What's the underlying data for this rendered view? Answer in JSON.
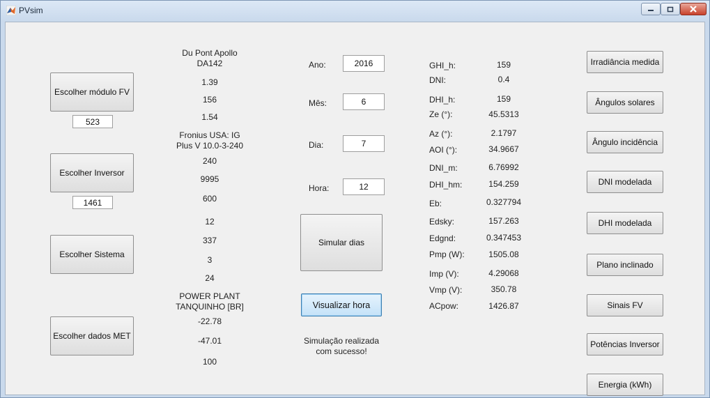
{
  "window": {
    "title": "PVsim"
  },
  "left_buttons": {
    "modulo": "Escolher módulo FV",
    "inversor": "Escolher Inversor",
    "sistema": "Escolher Sistema",
    "met": "Escolher dados MET"
  },
  "left_fields": {
    "modulo_id": "523",
    "inversor_id": "1461"
  },
  "info_column": {
    "module_name": "Du Pont Apollo\nDA142",
    "module_values": [
      "1.39",
      "156",
      "1.54"
    ],
    "inverter_name": "Fronius USA: IG\nPlus V 10.0-3-240",
    "inverter_values": [
      "240",
      "9995",
      "600"
    ],
    "system_values": [
      "12",
      "337",
      "3",
      "24"
    ],
    "met_name": "POWER PLANT\nTANQUINHO [BR]",
    "met_values": [
      "-22.78",
      "-47.01",
      "100"
    ]
  },
  "date_inputs": [
    {
      "label": "Ano:",
      "value": "2016"
    },
    {
      "label": "Mês:",
      "value": "6"
    },
    {
      "label": "Dia:",
      "value": "7"
    },
    {
      "label": "Hora:",
      "value": "12"
    }
  ],
  "actions": {
    "simular": "Simular dias",
    "visualizar": "Visualizar hora",
    "status": "Simulação realizada\ncom sucesso!"
  },
  "results": [
    {
      "label": "GHI_h:",
      "value": "159"
    },
    {
      "label": "DNI:",
      "value": "0.4"
    },
    {
      "label": "DHI_h:",
      "value": "159"
    },
    {
      "label": "Ze (°):",
      "value": "45.5313"
    },
    {
      "label": "Az (°):",
      "value": "2.1797"
    },
    {
      "label": "AOI (°):",
      "value": "34.9667"
    },
    {
      "label": "DNI_m:",
      "value": "6.76992"
    },
    {
      "label": "DHI_hm:",
      "value": "154.259"
    },
    {
      "label": "Eb:",
      "value": "0.327794"
    },
    {
      "label": "Edsky:",
      "value": "157.263"
    },
    {
      "label": "Edgnd:",
      "value": "0.347453"
    },
    {
      "label": "Pmp (W):",
      "value": "1505.08"
    },
    {
      "label": "Imp (V):",
      "value": "4.29068"
    },
    {
      "label": "Vmp (V):",
      "value": "350.78"
    },
    {
      "label": "ACpow:",
      "value": "1426.87"
    }
  ],
  "right_buttons": [
    "Irradiância medida",
    "Ângulos solares",
    "Ângulo incidência",
    "DNI modelada",
    "DHI modelada",
    "Plano inclinado",
    "Sinais FV",
    "Potências Inversor",
    "Energia (kWh)"
  ]
}
